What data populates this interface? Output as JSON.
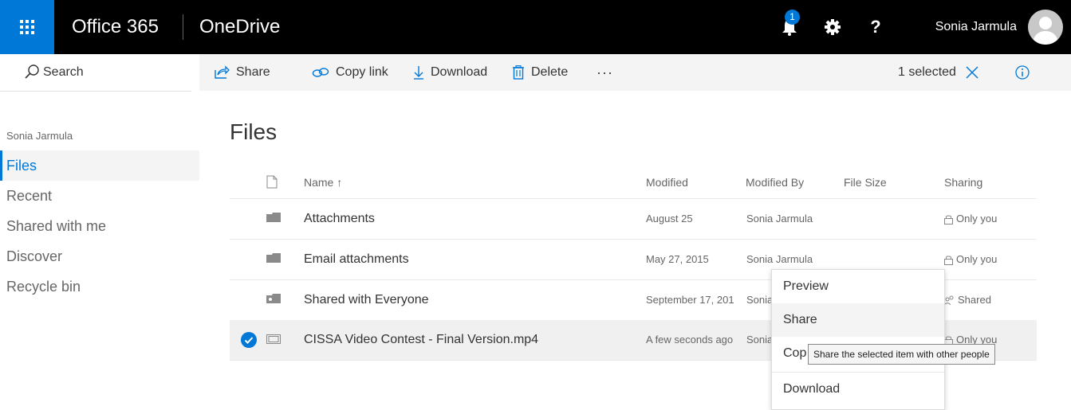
{
  "topbar": {
    "suite_title": "Office 365",
    "app_title": "OneDrive",
    "notification_count": "1",
    "help_label": "?",
    "user_name": "Sonia Jarmula"
  },
  "leftnav": {
    "search_label": "Search",
    "owner": "Sonia Jarmula",
    "items": [
      {
        "label": "Files",
        "active": true
      },
      {
        "label": "Recent"
      },
      {
        "label": "Shared with me"
      },
      {
        "label": "Discover"
      },
      {
        "label": "Recycle bin"
      }
    ]
  },
  "commandbar": {
    "share": "Share",
    "copy_link": "Copy link",
    "download": "Download",
    "delete": "Delete",
    "more": "···",
    "selected_text": "1 selected"
  },
  "page_title": "Files",
  "columns": {
    "name": "Name ↑",
    "modified": "Modified",
    "modified_by": "Modified By",
    "file_size": "File Size",
    "sharing": "Sharing"
  },
  "rows": [
    {
      "name": "Attachments",
      "modified": "August 25",
      "modified_by": "Sonia Jarmula",
      "sharing": "Only you"
    },
    {
      "name": "Email attachments",
      "modified": "May 27, 2015",
      "modified_by": "Sonia Jarmula",
      "sharing": "Only you"
    },
    {
      "name": "Shared with Everyone",
      "modified": "September 17, 201",
      "modified_by": "Sonia",
      "sharing": "Shared"
    },
    {
      "name": "CISSA Video Contest - Final Version.mp4",
      "modified": "A few seconds ago",
      "modified_by": "Sonia",
      "sharing": "Only you"
    }
  ],
  "context_menu": {
    "items": [
      "Preview",
      "Share",
      "Cop",
      "Download"
    ]
  },
  "tooltip": "Share the selected item with other people",
  "colors": {
    "accent": "#0078d7",
    "topbar": "#000000"
  }
}
